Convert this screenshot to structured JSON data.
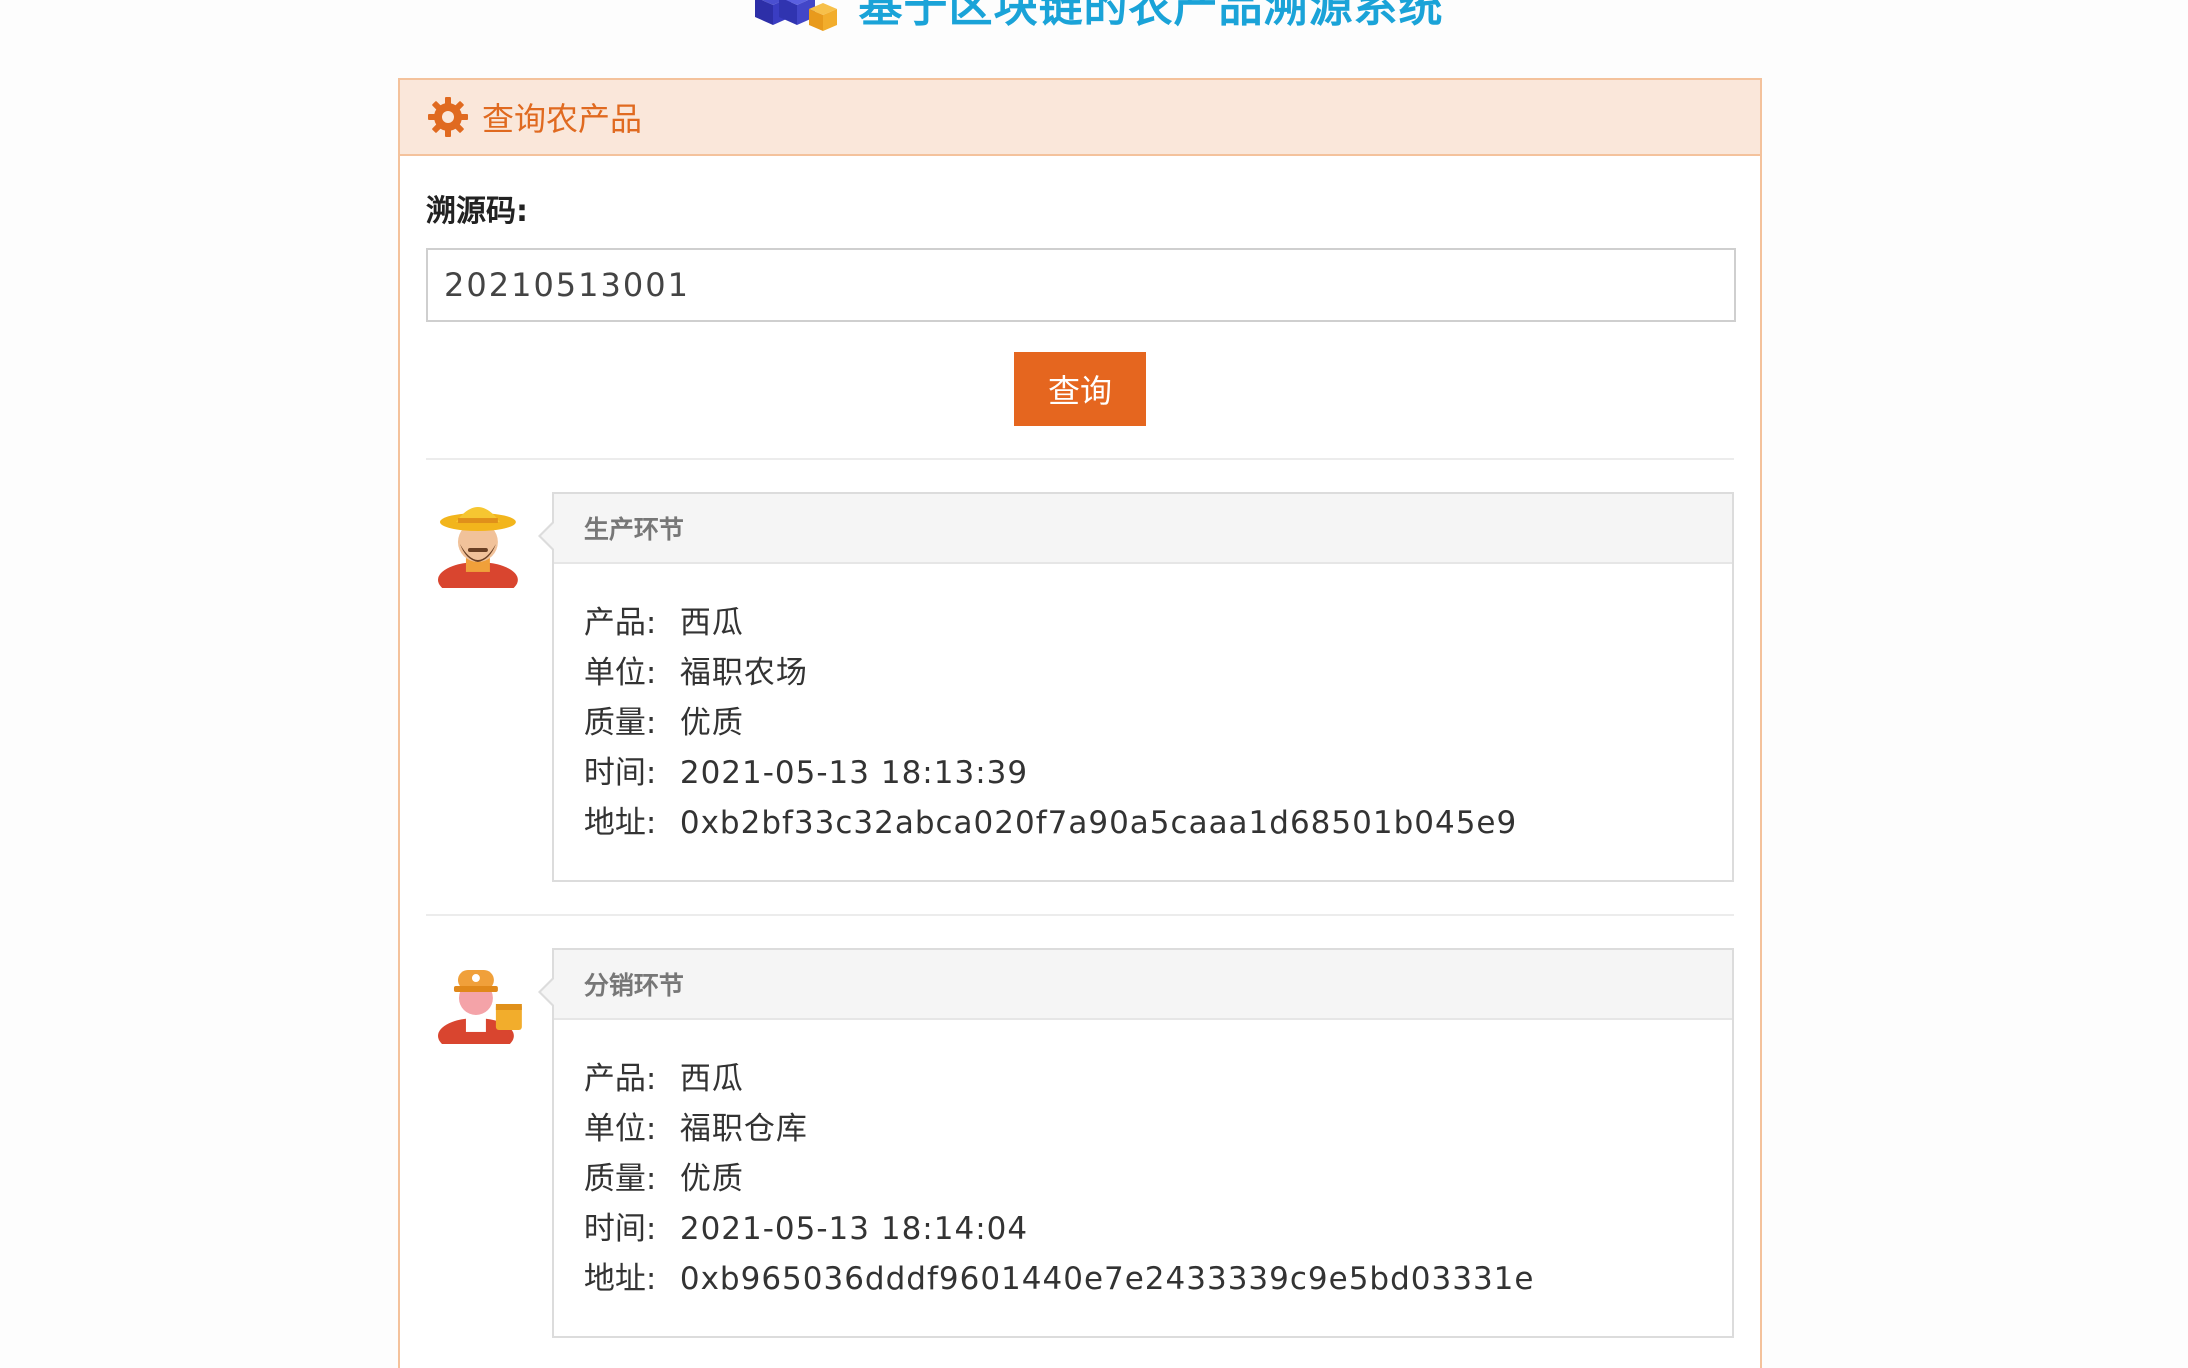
{
  "header": {
    "site_title": "基于区块链的农产品溯源系统"
  },
  "panel": {
    "title": "查询农产品",
    "field_label": "溯源码:",
    "trace_code_value": "20210513001",
    "query_button": "查询"
  },
  "stages": [
    {
      "title": "生产环节",
      "avatar_icon": "farmer-icon",
      "fields": [
        {
          "key": "产品:",
          "value": "西瓜"
        },
        {
          "key": "单位:",
          "value": "福职农场"
        },
        {
          "key": "质量:",
          "value": "优质"
        },
        {
          "key": "时间:",
          "value": "2021-05-13 18:13:39"
        },
        {
          "key": "地址:",
          "value": "0xb2bf33c32abca020f7a90a5caaa1d68501b045e9"
        }
      ]
    },
    {
      "title": "分销环节",
      "avatar_icon": "distributor-icon",
      "fields": [
        {
          "key": "产品:",
          "value": "西瓜"
        },
        {
          "key": "单位:",
          "value": "福职仓库"
        },
        {
          "key": "质量:",
          "value": "优质"
        },
        {
          "key": "时间:",
          "value": "2021-05-13 18:14:04"
        },
        {
          "key": "地址:",
          "value": "0xb965036dddf9601440e7e2433339c9e5bd03331e"
        }
      ]
    }
  ],
  "colors": {
    "brand_blue": "#1aa3d8",
    "accent_orange": "#e5661f",
    "panel_header_bg": "#fae7da",
    "panel_border": "#f4c29c"
  }
}
